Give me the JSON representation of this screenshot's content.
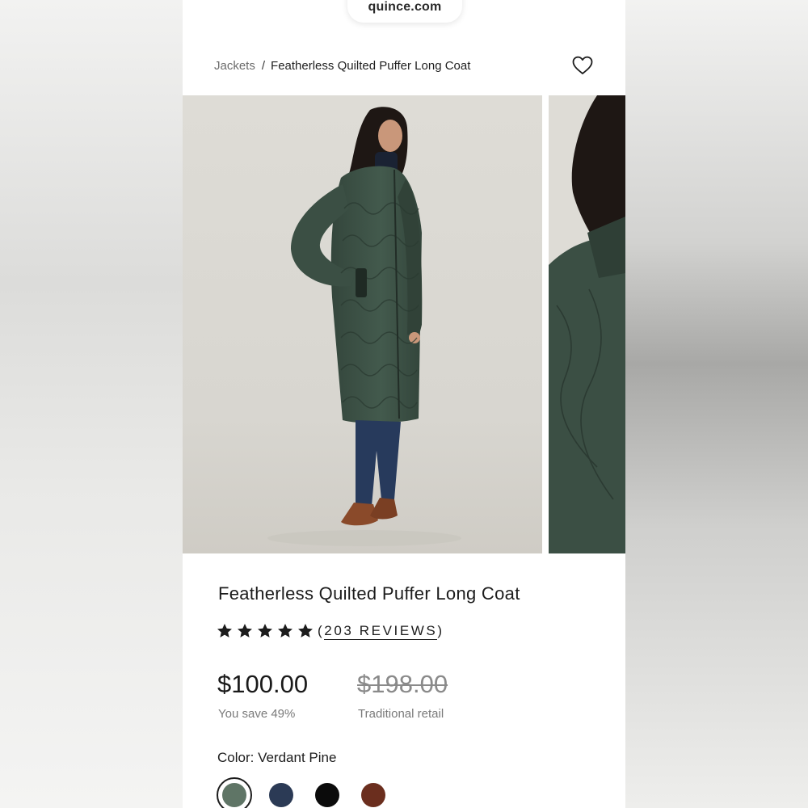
{
  "browser": {
    "url": "quince.com"
  },
  "breadcrumb": {
    "parent": "Jackets",
    "separator": "/",
    "current": "Featherless Quilted Puffer Long Coat"
  },
  "product": {
    "title": "Featherless Quilted Puffer Long Coat",
    "rating": 5,
    "reviews_open": "(",
    "reviews_label": "203 REVIEWS",
    "reviews_close": ")",
    "price": "$100.00",
    "savings": "You save 49%",
    "retail_price": "$198.00",
    "retail_label": "Traditional retail",
    "color_label": "Color: ",
    "color_value": "Verdant Pine",
    "swatches": [
      {
        "name": "Verdant Pine",
        "hex": "#5f7566",
        "selected": true
      },
      {
        "name": "navy",
        "hex": "#2b3a55",
        "selected": false
      },
      {
        "name": "black",
        "hex": "#0b0b0b",
        "selected": false
      },
      {
        "name": "brown",
        "hex": "#6b2e1e",
        "selected": false
      }
    ]
  },
  "icons": {
    "wishlist": "heart-icon",
    "star": "star-icon"
  },
  "colors": {
    "coat": "#3d5146",
    "jeans": "#273a5c",
    "shoes": "#8a4a2a",
    "text": "#1c1c1c"
  }
}
